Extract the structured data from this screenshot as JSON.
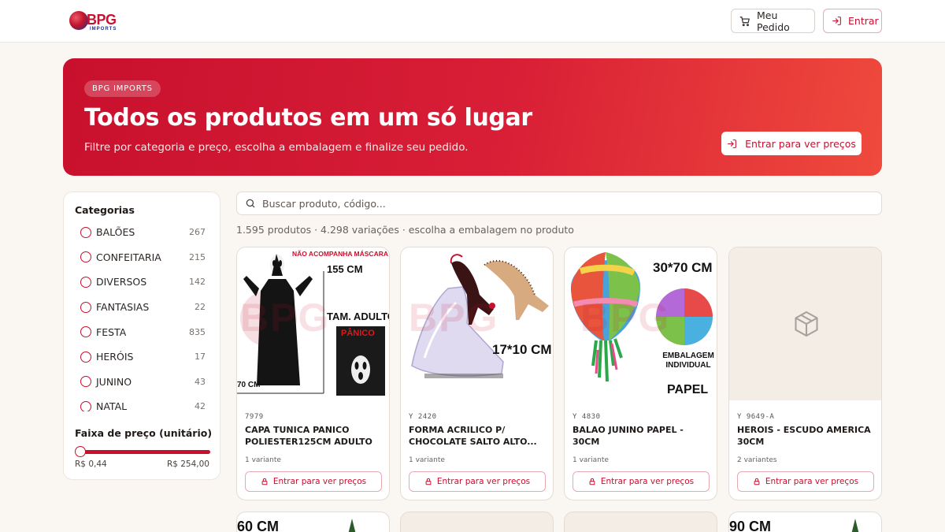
{
  "header": {
    "logo_text": "BPG",
    "logo_sub": "IMPORTS",
    "order_button": "Meu Pedido",
    "login_button": "Entrar"
  },
  "hero": {
    "badge": "BPG IMPORTS",
    "title": "Todos os produtos em um só lugar",
    "subtitle": "Filtre por categoria e preço, escolha a embalagem e finalize seu pedido.",
    "button": "Entrar para ver preços"
  },
  "sidebar": {
    "categories_title": "Categorias",
    "categories": [
      {
        "name": "BALÕES",
        "count": "267"
      },
      {
        "name": "CONFEITARIA",
        "count": "215"
      },
      {
        "name": "DIVERSOS",
        "count": "142"
      },
      {
        "name": "FANTASIAS",
        "count": "22"
      },
      {
        "name": "FESTA",
        "count": "835"
      },
      {
        "name": "HERÓIS",
        "count": "17"
      },
      {
        "name": "JUNINO",
        "count": "43"
      },
      {
        "name": "NATAL",
        "count": "42"
      }
    ],
    "price_title": "Faixa de preço (unitário)",
    "price_min": "R$ 0,44",
    "price_max": "R$ 254,00"
  },
  "search": {
    "placeholder": "Buscar produto, código..."
  },
  "summary": "1.595 produtos · 4.298 variações · escolha a embalagem no produto",
  "products": [
    {
      "code": "7979",
      "name": "CAPA TUNICA PANICO POLIESTER125CM ADULTO",
      "variants": "1 variante",
      "button": "Entrar para ver preços",
      "img_texts": [
        "NÃO ACOMPANHA MÁSCARA",
        "155 CM",
        "TAM. ADULTO",
        "PÂNICO",
        "70 CM"
      ]
    },
    {
      "code": "Y 2420",
      "name": "FORMA ACRILICO P/ CHOCOLATE SALTO ALTO...",
      "variants": "1 variante",
      "button": "Entrar para ver preços",
      "img_texts": [
        "17*10 CM"
      ]
    },
    {
      "code": "Y 4830",
      "name": "BALAO JUNINO PAPEL - 30CM",
      "variants": "1 variante",
      "button": "Entrar para ver preços",
      "img_texts": [
        "30*70 CM",
        "EMBALAGEM INDIVIDUAL",
        "PAPEL"
      ]
    },
    {
      "code": "Y 9649-A",
      "name": "HEROIS - ESCUDO AMERICA 30CM",
      "variants": "2 variantes",
      "button": "Entrar para ver preços",
      "img_texts": []
    }
  ],
  "next_row": [
    "60 CM",
    "",
    "",
    "90 CM"
  ],
  "watermark": "BPG",
  "colors": {
    "brand": "#c8102e",
    "background": "#faf6f1"
  }
}
